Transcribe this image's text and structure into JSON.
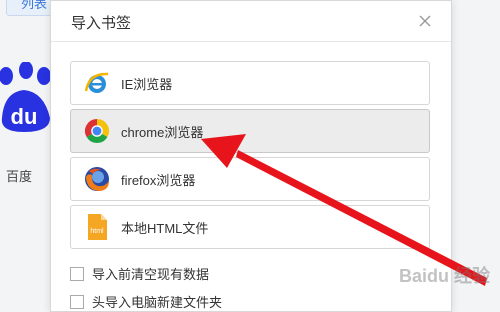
{
  "background": {
    "tab_label": "列表",
    "logo_text": "du",
    "caption": "百度"
  },
  "dialog": {
    "title": "导入书签",
    "options": [
      {
        "label": "IE浏览器",
        "icon": "ie-icon"
      },
      {
        "label": "chrome浏览器",
        "icon": "chrome-icon",
        "selected": true
      },
      {
        "label": "firefox浏览器",
        "icon": "firefox-icon"
      },
      {
        "label": "本地HTML文件",
        "icon": "html-file-icon",
        "icon_text": "html"
      }
    ],
    "checkboxes": [
      {
        "label": "导入前清空现有数据",
        "checked": false
      },
      {
        "label": "头导入电脑新建文件夹",
        "checked": false
      }
    ]
  },
  "watermark": "Baidu 经验",
  "colors": {
    "arrow": "#e8141b",
    "accent": "#3b78d8"
  }
}
